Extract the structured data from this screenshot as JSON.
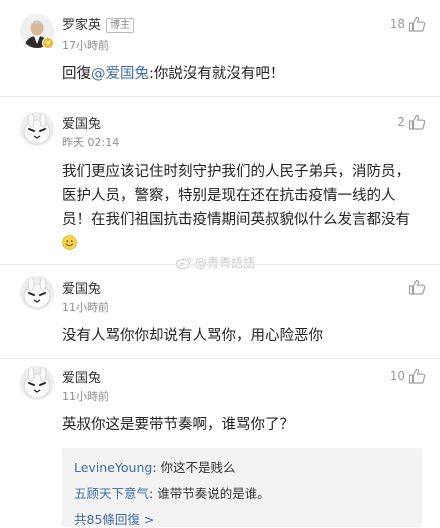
{
  "comments": [
    {
      "username": "罗家英",
      "badge": "博主",
      "time": "17小時前",
      "likes": "18",
      "text_prefix": "回復",
      "mention": "@爱国兔",
      "text": ":你説沒有就沒有吧！"
    },
    {
      "username": "爱国兔",
      "time": "昨天 02:14",
      "likes": "2",
      "text": "我们更应该记住时刻守护我们的人民子弟兵，消防员，医护人员，警察，特别是现在还在抗击疫情一线的人员！在我们祖国抗击疫情期间英叔貌似什么发言都没有"
    },
    {
      "username": "爱国兔",
      "time": "11小時前",
      "likes": "",
      "text": "没有人骂你你却说有人骂你，用心险恶你"
    },
    {
      "username": "爱国兔",
      "time": "11小時前",
      "likes": "10",
      "text": "英叔你这是要带节奏啊，谁骂你了？"
    }
  ],
  "replies": [
    {
      "user": "LevineYoung",
      "text": ": 你这不是贱么"
    },
    {
      "user": "五顾天下意气",
      "text": ": 谁带节奏说的是谁。"
    }
  ],
  "more_replies": "共85條回復 >",
  "watermark": "@青青語語",
  "colors": {
    "link": "#3d6ca8",
    "vip_badge": "#f6b521",
    "meta": "#8e8e8e"
  },
  "icons": [
    "thumbs-up-icon",
    "smile-emoji-icon",
    "weibo-logo-icon",
    "verified-icon"
  ]
}
